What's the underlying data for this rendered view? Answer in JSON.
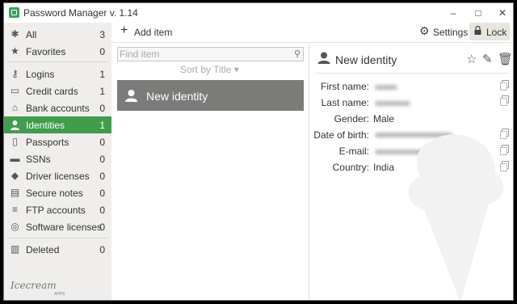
{
  "window": {
    "title": "Password Manager v. 1.14",
    "controls": {
      "minimize": "–",
      "maximize": "□",
      "close": "✕"
    }
  },
  "sidebar": {
    "items": [
      {
        "label": "All",
        "count": "3",
        "icon": "asterisk-icon",
        "glyph": "✱"
      },
      {
        "label": "Favorites",
        "count": "0",
        "icon": "star-icon",
        "glyph": "★"
      },
      {
        "label": "Logins",
        "count": "1",
        "icon": "key-icon",
        "glyph": "⚷"
      },
      {
        "label": "Credit cards",
        "count": "1",
        "icon": "credit-card-icon",
        "glyph": "▭"
      },
      {
        "label": "Bank accounts",
        "count": "0",
        "icon": "bank-icon",
        "glyph": "⌂"
      },
      {
        "label": "Identities",
        "count": "1",
        "icon": "person-icon",
        "glyph": "●",
        "active": true
      },
      {
        "label": "Passports",
        "count": "0",
        "icon": "passport-icon",
        "glyph": "▯"
      },
      {
        "label": "SSNs",
        "count": "0",
        "icon": "id-card-icon",
        "glyph": "▬"
      },
      {
        "label": "Driver licenses",
        "count": "0",
        "icon": "car-icon",
        "glyph": "◆"
      },
      {
        "label": "Secure notes",
        "count": "0",
        "icon": "note-icon",
        "glyph": "▤"
      },
      {
        "label": "FTP accounts",
        "count": "0",
        "icon": "server-icon",
        "glyph": "≡"
      },
      {
        "label": "Software licenses",
        "count": "0",
        "icon": "globe-icon",
        "glyph": "◎"
      },
      {
        "label": "Deleted",
        "count": "0",
        "icon": "trash-icon",
        "glyph": "▥"
      }
    ],
    "brand": "Icecream",
    "brand_sub": "APPS"
  },
  "toolbar": {
    "add_label": "Add item",
    "settings_label": "Settings",
    "lock_label": "Lock"
  },
  "list": {
    "search_placeholder": "Find item",
    "sort_label": "Sort by Title ▾",
    "items": [
      {
        "title": "New identity"
      }
    ]
  },
  "detail": {
    "title": "New identity",
    "fields": [
      {
        "label": "First name:",
        "value": "",
        "redacted": true
      },
      {
        "label": "Last name:",
        "value": "",
        "redacted": true
      },
      {
        "label": "Gender:",
        "value": "Male",
        "redacted": false
      },
      {
        "label": "Date of birth:",
        "value": "",
        "redacted": true
      },
      {
        "label": "E-mail:",
        "value": "",
        "redacted": true
      },
      {
        "label": "Country:",
        "value": "India",
        "redacted": false
      }
    ]
  },
  "colors": {
    "accent": "#3f9d4b",
    "selected_item": "#7b7b79",
    "sidebar_bg": "#efeeec"
  }
}
